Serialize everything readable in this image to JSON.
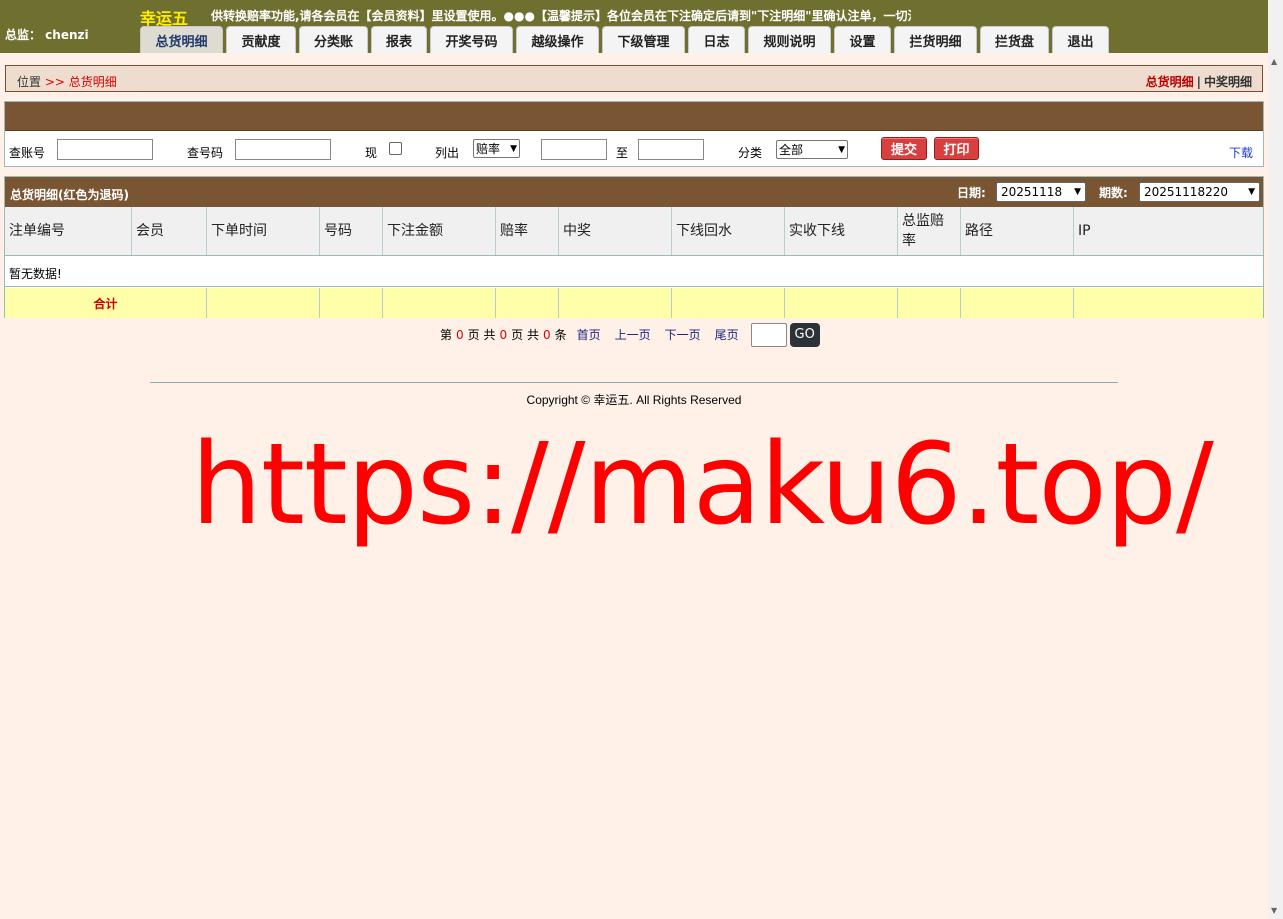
{
  "header": {
    "user_label": "总监： chenzi",
    "brand": "幸运五",
    "marquee": "供转换赔率功能,请各会员在【会员资料】里设置使用。●●●【温馨提示】各位会员在下注确定后请到\"下注明细\"里确认注单，一切注单"
  },
  "nav": [
    {
      "label": "总货明细",
      "active": true
    },
    {
      "label": "贡献度"
    },
    {
      "label": "分类账"
    },
    {
      "label": "报表"
    },
    {
      "label": "开奖号码"
    },
    {
      "label": "越级操作"
    },
    {
      "label": "下级管理"
    },
    {
      "label": "日志"
    },
    {
      "label": "规则说明"
    },
    {
      "label": "设置"
    },
    {
      "label": "拦货明细"
    },
    {
      "label": "拦货盘"
    },
    {
      "label": "退出"
    }
  ],
  "breadcrumb": {
    "location": "位置",
    "sep": ">>",
    "current": "总货明细",
    "right_active": "总货明细",
    "right_divider": "|",
    "right_link": "中奖明细"
  },
  "search": {
    "account_label": "查账号",
    "number_label": "查号码",
    "now_label": "现",
    "list_label": "列出",
    "list_select": "赔率",
    "to_label": "至",
    "category_label": "分类",
    "category_select": "全部",
    "submit": "提交",
    "print": "打印",
    "download": "下载"
  },
  "results": {
    "title": "总货明细(红色为退码)",
    "date_label": "日期:",
    "date_value": "20251118",
    "period_label": "期数:",
    "period_value": "20251118220",
    "columns": [
      "注单编号",
      "会员",
      "下单时间",
      "号码",
      "下注金额",
      "赔率",
      "中奖",
      "下线回水",
      "实收下线",
      "总监赔率",
      "路径",
      "IP"
    ],
    "empty_text": "暂无数据!",
    "total_label": "合计"
  },
  "pager": {
    "p1": "第",
    "current_page": "0",
    "p2": "页 共",
    "total_pages": "0",
    "p3": "页 共",
    "total_items": "0",
    "p4": "条",
    "first": "首页",
    "prev": "上一页",
    "next": "下一页",
    "last": "尾页",
    "go": "GO"
  },
  "footer": {
    "copyright": "Copyright © 幸运五. All Rights Reserved",
    "watermark": "https://maku6.top/"
  }
}
